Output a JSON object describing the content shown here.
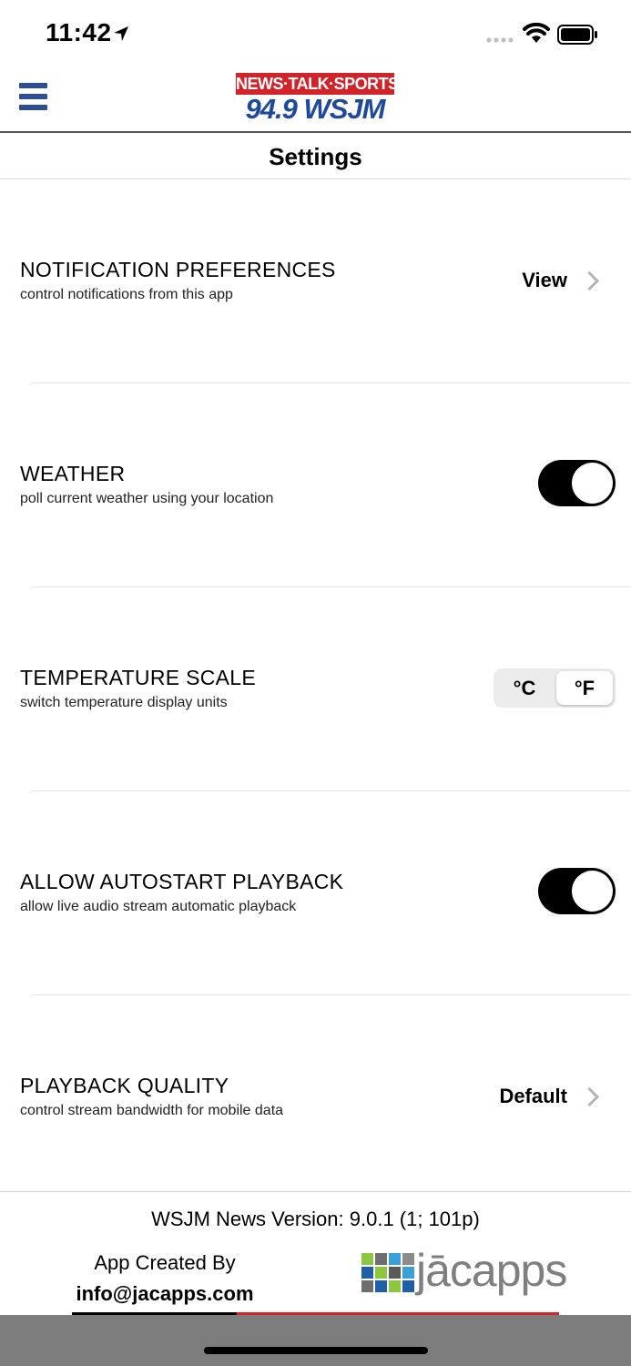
{
  "status_bar": {
    "time": "11:42"
  },
  "header": {
    "logo_top": "NEWS·TALK·SPORTS",
    "logo_bottom": "94.9 WSJM"
  },
  "page": {
    "title": "Settings"
  },
  "settings": [
    {
      "title": "NOTIFICATION PREFERENCES",
      "subtitle": "control notifications from this app",
      "value": "View"
    },
    {
      "title": "WEATHER",
      "subtitle": "poll current weather using your location",
      "toggle_on": true
    },
    {
      "title": "TEMPERATURE SCALE",
      "subtitle": "switch temperature display units",
      "options": [
        "°C",
        "°F"
      ],
      "selected": "°F"
    },
    {
      "title": "ALLOW AUTOSTART PLAYBACK",
      "subtitle": "allow live audio stream automatic playback",
      "toggle_on": true
    },
    {
      "title": "PLAYBACK QUALITY",
      "subtitle": "control stream bandwidth for mobile data",
      "value": "Default"
    }
  ],
  "footer": {
    "version": "WSJM News  Version: 9.0.1 (1; 101p)",
    "created_by": "App Created By",
    "email": "info@jacapps.com",
    "logo_text": "jācapps"
  },
  "colors": {
    "brand_blue": "#2b4e96",
    "brand_red": "#d1232a",
    "toggle_on": "#000000"
  }
}
